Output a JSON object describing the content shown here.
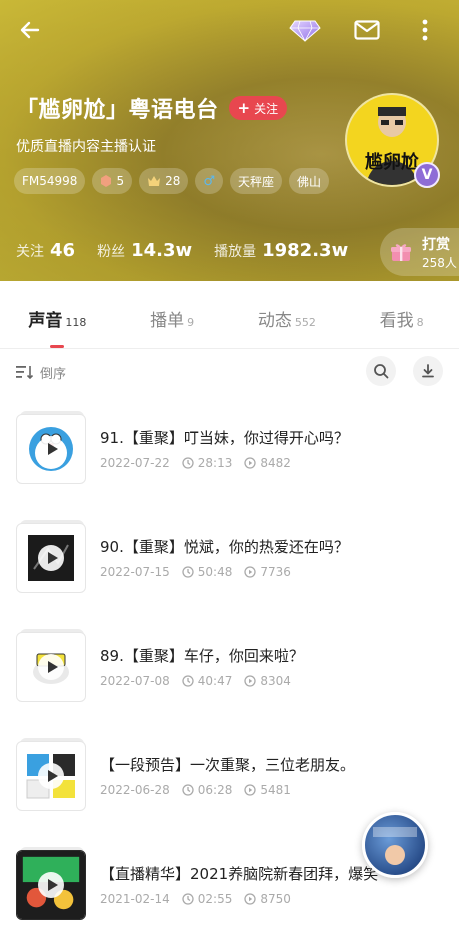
{
  "header": {
    "anchor_name": "「尴卵尬」粤语电台",
    "follow_label": "关注",
    "certification": "优质直播内容主播认证",
    "tags": [
      {
        "icon": "fm",
        "label": "FM54998"
      },
      {
        "icon": "badge-icon",
        "label": "5"
      },
      {
        "icon": "crown-icon",
        "label": "28"
      },
      {
        "icon": "male-icon",
        "label": "♂"
      },
      {
        "icon": "",
        "label": "天秤座"
      },
      {
        "icon": "",
        "label": "佛山"
      }
    ],
    "stats": [
      {
        "label": "关注",
        "value": "46"
      },
      {
        "label": "粉丝",
        "value": "14.3w"
      },
      {
        "label": "播放量",
        "value": "1982.3w"
      }
    ],
    "tip": {
      "title": "打赏",
      "count": "258人"
    },
    "verify_badge": "V",
    "avatar_text": "尴卵尬"
  },
  "tabs": [
    {
      "label": "声音",
      "count": "118",
      "active": true
    },
    {
      "label": "播单",
      "count": "9",
      "active": false
    },
    {
      "label": "动态",
      "count": "552",
      "active": false
    },
    {
      "label": "看我",
      "count": "8",
      "active": false
    }
  ],
  "sort": {
    "label": "倒序"
  },
  "tracks": [
    {
      "title": "91.【重聚】叮当妹，你过得开心吗？",
      "date": "2022-07-22",
      "duration": "28:13",
      "plays": "8482"
    },
    {
      "title": "90.【重聚】悦斌，你的热爱还在吗？",
      "date": "2022-07-15",
      "duration": "50:48",
      "plays": "7736"
    },
    {
      "title": "89.【重聚】车仔，你回来啦？",
      "date": "2022-07-08",
      "duration": "40:47",
      "plays": "8304"
    },
    {
      "title": "【一段预告】一次重聚，三位老朋友。",
      "date": "2022-06-28",
      "duration": "06:28",
      "plays": "5481"
    },
    {
      "title": "【直播精华】2021养脑院新春团拜，爆笑",
      "date": "2021-02-14",
      "duration": "02:55",
      "plays": "8750"
    }
  ],
  "colors": {
    "accent": "#e8474f",
    "header_bg": "#c7b233",
    "verify": "#8e6cd6"
  }
}
